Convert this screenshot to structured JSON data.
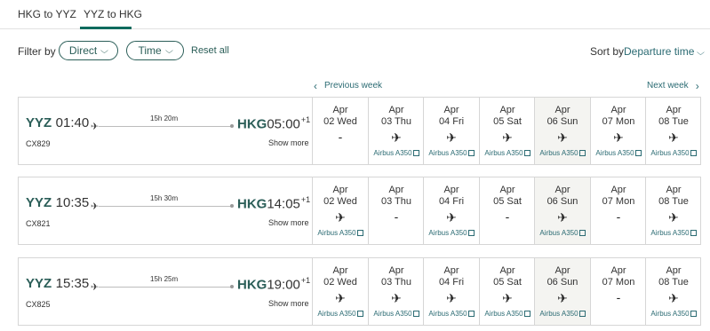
{
  "tabs": [
    {
      "label": "HKG to YYZ",
      "active": false
    },
    {
      "label": "YYZ to HKG",
      "active": true
    }
  ],
  "filter": {
    "label": "Filter by",
    "direct": "Direct",
    "time": "Time",
    "reset": "Reset all"
  },
  "sort": {
    "label": "Sort by",
    "value": "Departure time"
  },
  "nav": {
    "prev": "Previous week",
    "next": "Next week"
  },
  "aircraft_label": "Airbus A350",
  "flights": [
    {
      "from": "YYZ",
      "dep": "01:40",
      "to": "HKG",
      "arr": "05:00",
      "plus": "+1",
      "duration": "15h 20m",
      "flight_no": "CX829",
      "show_more": "Show more",
      "days": [
        {
          "m": "Apr",
          "d": "02 Wed",
          "available": false,
          "mark": "-"
        },
        {
          "m": "Apr",
          "d": "03 Thu",
          "available": true,
          "mark": "✈",
          "aircraft": "Airbus A350"
        },
        {
          "m": "Apr",
          "d": "04 Fri",
          "available": true,
          "mark": "✈",
          "aircraft": "Airbus A350"
        },
        {
          "m": "Apr",
          "d": "05 Sat",
          "available": true,
          "mark": "✈",
          "aircraft": "Airbus A350"
        },
        {
          "m": "Apr",
          "d": "06 Sun",
          "available": true,
          "mark": "✈",
          "aircraft": "Airbus A350"
        },
        {
          "m": "Apr",
          "d": "07 Mon",
          "available": true,
          "mark": "✈",
          "aircraft": "Airbus A350"
        },
        {
          "m": "Apr",
          "d": "08 Tue",
          "available": true,
          "mark": "✈",
          "aircraft": "Airbus A350"
        }
      ]
    },
    {
      "from": "YYZ",
      "dep": "10:35",
      "to": "HKG",
      "arr": "14:05",
      "plus": "+1",
      "duration": "15h 30m",
      "flight_no": "CX821",
      "show_more": "Show more",
      "days": [
        {
          "m": "Apr",
          "d": "02 Wed",
          "available": true,
          "mark": "✈",
          "aircraft": "Airbus A350"
        },
        {
          "m": "Apr",
          "d": "03 Thu",
          "available": false,
          "mark": "-"
        },
        {
          "m": "Apr",
          "d": "04 Fri",
          "available": true,
          "mark": "✈",
          "aircraft": "Airbus A350"
        },
        {
          "m": "Apr",
          "d": "05 Sat",
          "available": false,
          "mark": "-"
        },
        {
          "m": "Apr",
          "d": "06 Sun",
          "available": true,
          "mark": "✈",
          "aircraft": "Airbus A350"
        },
        {
          "m": "Apr",
          "d": "07 Mon",
          "available": false,
          "mark": "-"
        },
        {
          "m": "Apr",
          "d": "08 Tue",
          "available": true,
          "mark": "✈",
          "aircraft": "Airbus A350"
        }
      ]
    },
    {
      "from": "YYZ",
      "dep": "15:35",
      "to": "HKG",
      "arr": "19:00",
      "plus": "+1",
      "duration": "15h 25m",
      "flight_no": "CX825",
      "show_more": "Show more",
      "days": [
        {
          "m": "Apr",
          "d": "02 Wed",
          "available": true,
          "mark": "✈",
          "aircraft": "Airbus A350"
        },
        {
          "m": "Apr",
          "d": "03 Thu",
          "available": true,
          "mark": "✈",
          "aircraft": "Airbus A350"
        },
        {
          "m": "Apr",
          "d": "04 Fri",
          "available": true,
          "mark": "✈",
          "aircraft": "Airbus A350"
        },
        {
          "m": "Apr",
          "d": "05 Sat",
          "available": true,
          "mark": "✈",
          "aircraft": "Airbus A350"
        },
        {
          "m": "Apr",
          "d": "06 Sun",
          "available": true,
          "mark": "✈",
          "aircraft": "Airbus A350"
        },
        {
          "m": "Apr",
          "d": "07 Mon",
          "available": false,
          "mark": "-"
        },
        {
          "m": "Apr",
          "d": "08 Tue",
          "available": true,
          "mark": "✈",
          "aircraft": "Airbus A350"
        }
      ]
    }
  ]
}
